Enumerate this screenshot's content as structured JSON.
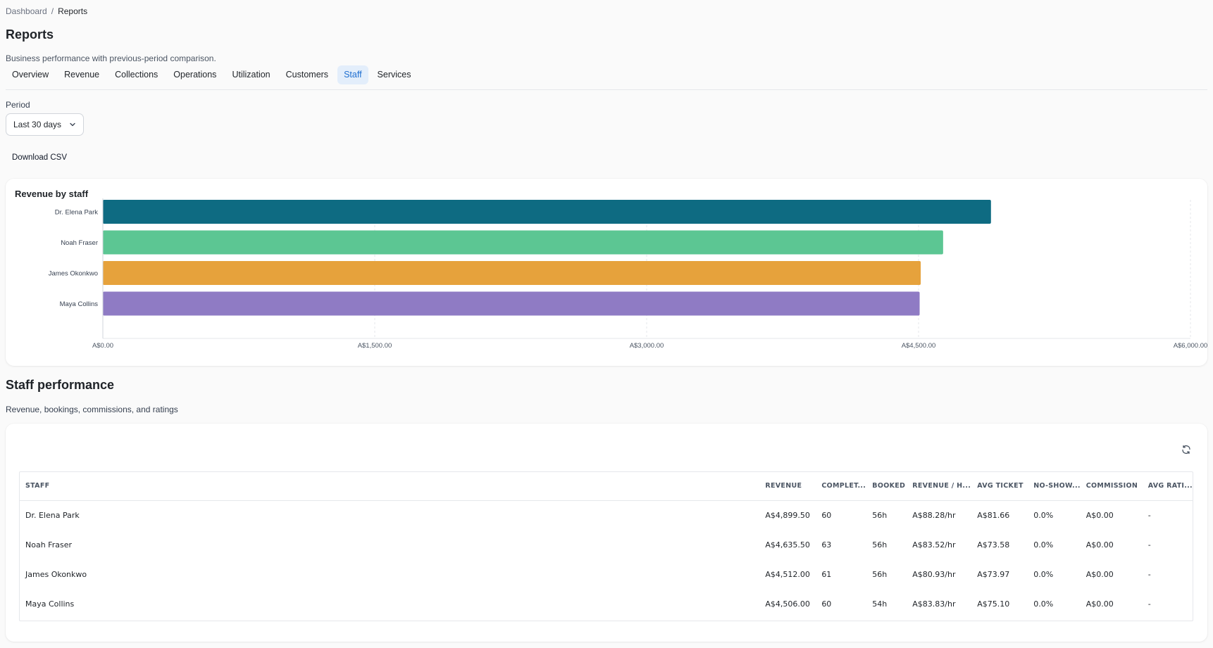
{
  "breadcrumb": {
    "root": "Dashboard",
    "separator": "/",
    "current": "Reports"
  },
  "page": {
    "title": "Reports",
    "subtitle": "Business performance with previous-period comparison."
  },
  "tabs": [
    {
      "label": "Overview",
      "active": false
    },
    {
      "label": "Revenue",
      "active": false
    },
    {
      "label": "Collections",
      "active": false
    },
    {
      "label": "Operations",
      "active": false
    },
    {
      "label": "Utilization",
      "active": false
    },
    {
      "label": "Customers",
      "active": false
    },
    {
      "label": "Staff",
      "active": true
    },
    {
      "label": "Services",
      "active": false
    }
  ],
  "filters": {
    "period_label": "Period",
    "period_value": "Last 30 days"
  },
  "actions": {
    "download_csv": "Download CSV",
    "refresh_icon": "refresh-icon"
  },
  "chart_data": {
    "type": "bar",
    "orientation": "horizontal",
    "title": "Revenue by staff",
    "categories": [
      "Dr. Elena Park",
      "Noah Fraser",
      "James Okonkwo",
      "Maya Collins"
    ],
    "values": [
      4899.5,
      4635.5,
      4512.0,
      4506.0
    ],
    "colors": [
      "#0e6b82",
      "#5cc693",
      "#e6a23c",
      "#8f7bc4"
    ],
    "xlim": [
      0,
      6000
    ],
    "xticks": [
      0,
      1500,
      3000,
      4500,
      6000
    ],
    "xtick_labels": [
      "A$0.00",
      "A$1,500.00",
      "A$3,000.00",
      "A$4,500.00",
      "A$6,000.00"
    ],
    "grid": true
  },
  "staff_section": {
    "title": "Staff performance",
    "subtitle": "Revenue, bookings, commissions, and ratings"
  },
  "table": {
    "columns": [
      "STAFF",
      "REVENUE",
      "COMPLET...",
      "BOOKED",
      "REVENUE / H...",
      "AVG TICKET",
      "NO-SHOW...",
      "COMMISSION",
      "AVG RATI..."
    ],
    "rows": [
      [
        "Dr. Elena Park",
        "A$4,899.50",
        "60",
        "56h",
        "A$88.28/hr",
        "A$81.66",
        "0.0%",
        "A$0.00",
        "-"
      ],
      [
        "Noah Fraser",
        "A$4,635.50",
        "63",
        "56h",
        "A$83.52/hr",
        "A$73.58",
        "0.0%",
        "A$0.00",
        "-"
      ],
      [
        "James Okonkwo",
        "A$4,512.00",
        "61",
        "56h",
        "A$80.93/hr",
        "A$73.97",
        "0.0%",
        "A$0.00",
        "-"
      ],
      [
        "Maya Collins",
        "A$4,506.00",
        "60",
        "54h",
        "A$83.83/hr",
        "A$75.10",
        "0.0%",
        "A$0.00",
        "-"
      ]
    ]
  }
}
